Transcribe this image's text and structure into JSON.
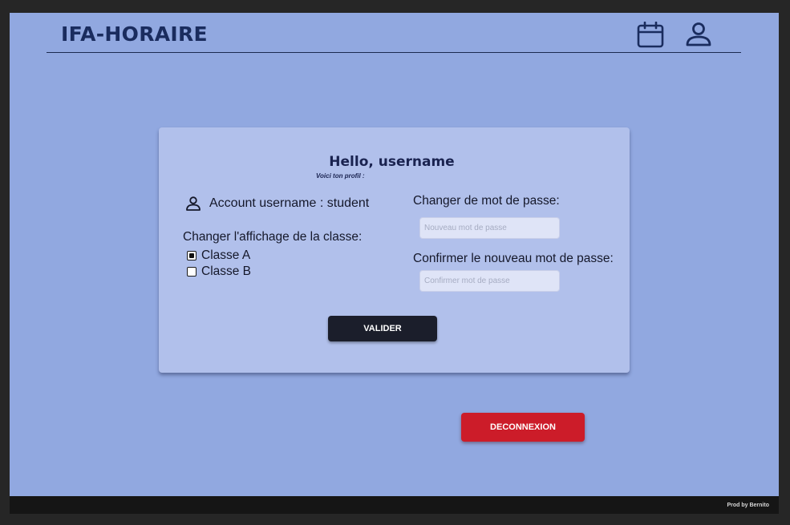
{
  "header": {
    "brand": "IFA-HORAIRE",
    "icons": [
      "calendar-icon",
      "user-icon"
    ]
  },
  "profile": {
    "greeting": "Hello, username",
    "subtitle": "Voici ton profil :",
    "account_text": "Account username : student",
    "class_section_title": "Changer l'affichage de la classe:",
    "class_options": [
      {
        "label": "Classe A",
        "checked": true
      },
      {
        "label": "Classe B",
        "checked": false
      }
    ],
    "password_label": "Changer de mot de passe:",
    "password_placeholder": "Nouveau mot de passe",
    "password_value": "",
    "confirm_label": "Confirmer le nouveau mot de passe:",
    "confirm_placeholder": "Confirmer mot de passe",
    "confirm_value": "",
    "submit_label": "VALIDER"
  },
  "logout_label": "DECONNEXION",
  "footer": {
    "credit": "Prod by Bernito"
  },
  "colors": {
    "background": "#91a8e0",
    "card": "#b1c0eb",
    "brand_text": "#1a2c5e",
    "submit_button": "#1b1e2b",
    "logout_button": "#cc1c29",
    "footer": "#151515"
  }
}
